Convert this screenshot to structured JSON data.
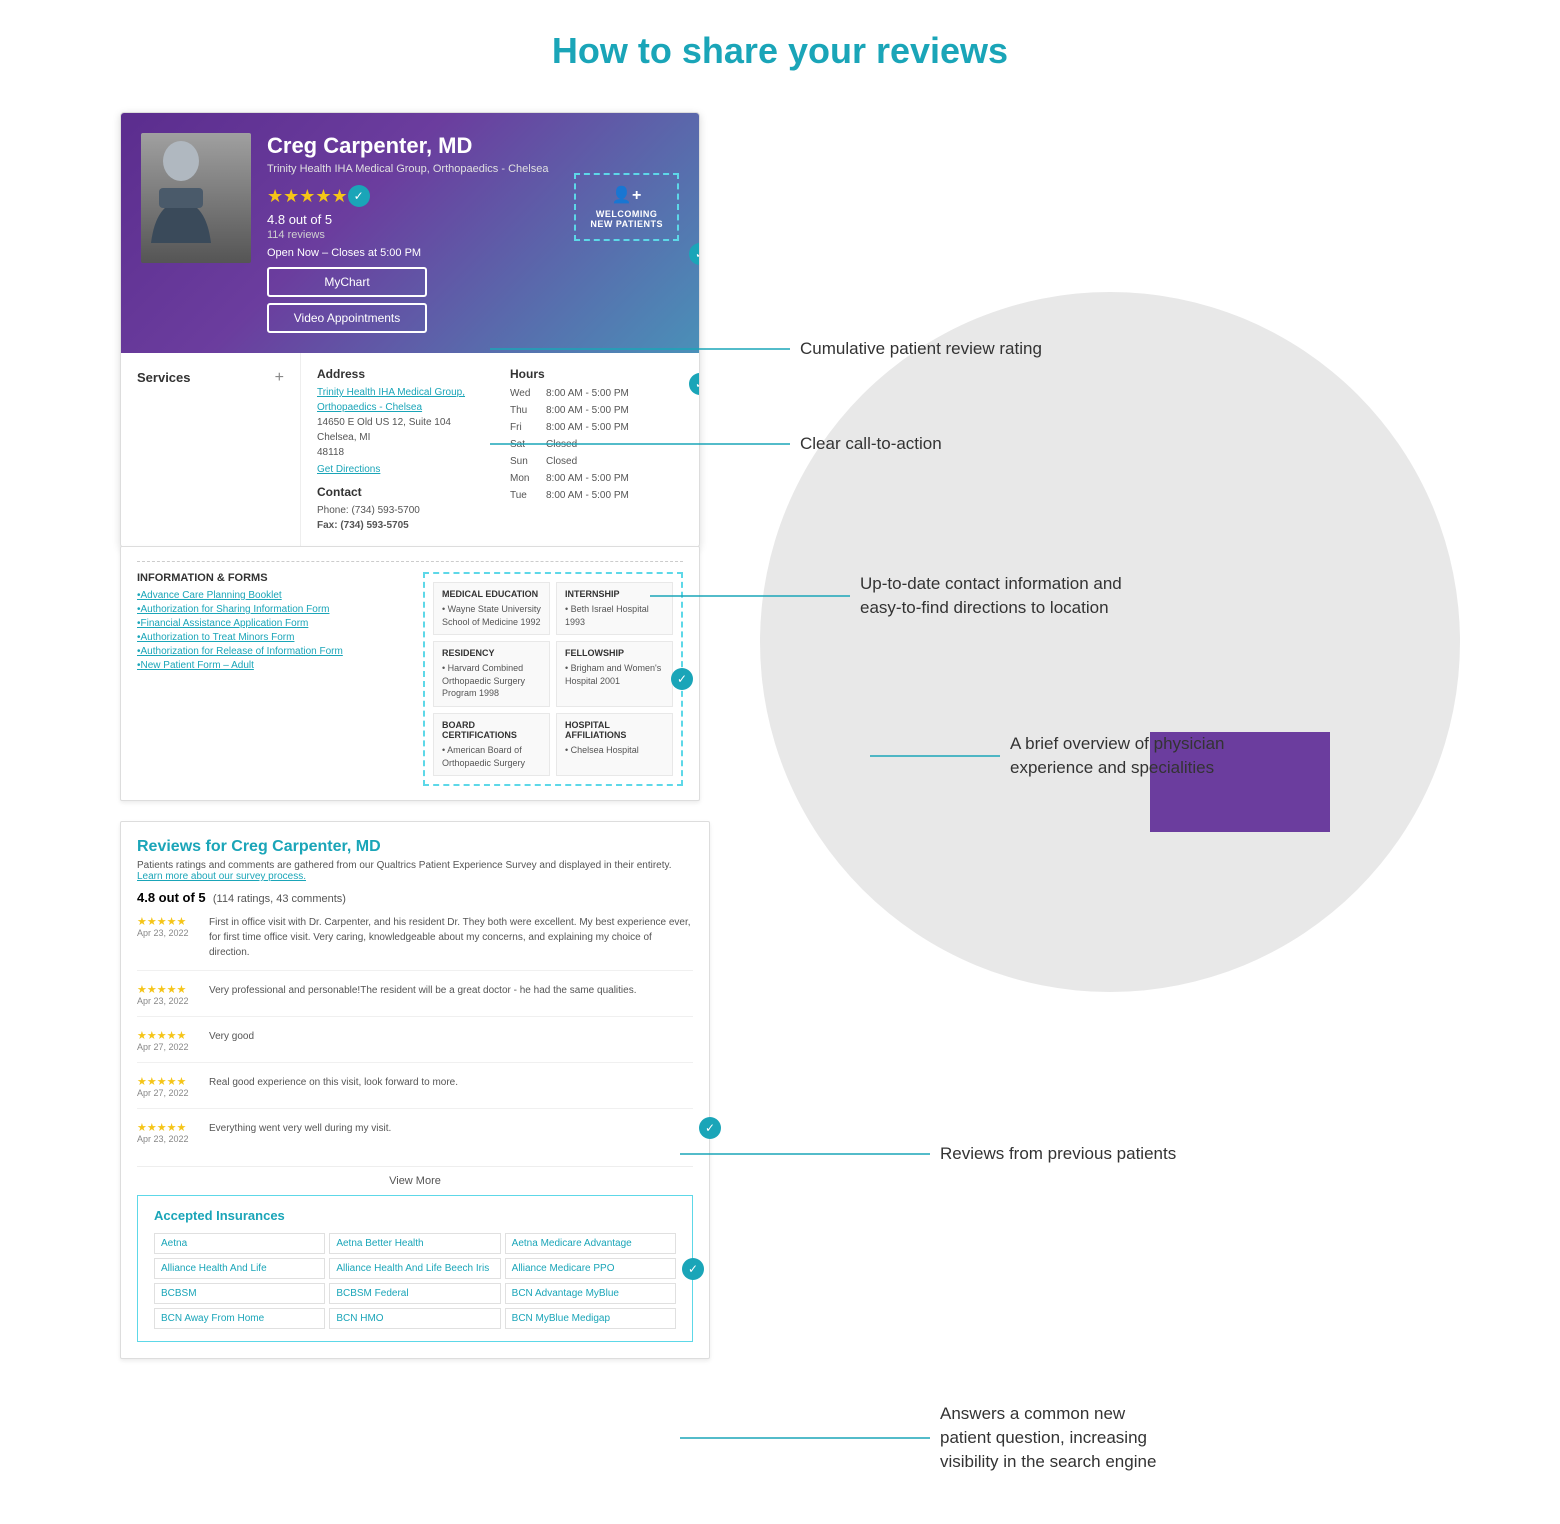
{
  "page": {
    "title": "How to share your reviews"
  },
  "doctor": {
    "name": "Creg Carpenter, MD",
    "organization": "Trinity Health IHA Medical Group, Orthopaedics - Chelsea",
    "rating": "4.8",
    "rating_suffix": "out of 5",
    "review_count": "114 reviews",
    "stars": "★★★★★",
    "open_status": "Open Now",
    "close_time": "– Closes at 5:00 PM",
    "btn_mychart": "MyChart",
    "btn_video": "Video Appointments",
    "welcoming_label": "WELCOMING\nNEW PATIENTS"
  },
  "address": {
    "label": "Address",
    "line1": "Trinity Health IHA Medical Group,",
    "line2": "Orthopaedics - Chelsea",
    "line3": "14650 E Old US 12, Suite 104",
    "line4": "Chelsea, MI",
    "line5": "48118",
    "directions": "Get Directions",
    "contact_label": "Contact",
    "phone": "Phone: (734) 593-5700",
    "fax": "Fax: (734) 593-5705"
  },
  "hours": {
    "label": "Hours",
    "days": [
      {
        "day": "Wed",
        "time": "8:00 AM - 5:00 PM"
      },
      {
        "day": "Thu",
        "time": "8:00 AM - 5:00 PM"
      },
      {
        "day": "Fri",
        "time": "8:00 AM - 5:00 PM"
      },
      {
        "day": "Sat",
        "time": "Closed"
      },
      {
        "day": "Sun",
        "time": "Closed"
      },
      {
        "day": "Mon",
        "time": "8:00 AM - 5:00 PM"
      },
      {
        "day": "Tue",
        "time": "8:00 AM - 5:00 PM"
      }
    ]
  },
  "sidebar": {
    "services_label": "Services"
  },
  "forms": {
    "title": "INFORMATION & FORMS",
    "links": [
      "Advance Care Planning Booklet",
      "Authorization for Sharing Information Form",
      "Financial Assistance Application Form",
      "Authorization to Treat Minors Form",
      "Authorization for Release of Information Form",
      "New Patient Form – Adult"
    ]
  },
  "credentials": {
    "medical_education": {
      "title": "MEDICAL EDUCATION",
      "items": [
        "Wayne State University School of Medicine 1992"
      ]
    },
    "internship": {
      "title": "INTERNSHIP",
      "items": [
        "Beth Israel Hospital 1993"
      ]
    },
    "residency": {
      "title": "RESIDENCY",
      "items": [
        "Harvard Combined Orthopaedic Surgery Program 1998"
      ]
    },
    "fellowship": {
      "title": "FELLOWSHIP",
      "items": [
        "Brigham and Women's Hospital 2001"
      ]
    },
    "board": {
      "title": "BOARD CERTIFICATIONS",
      "items": [
        "American Board of Orthopaedic Surgery"
      ]
    },
    "hospital": {
      "title": "HOSPITAL AFFILIATIONS",
      "items": [
        "Chelsea Hospital"
      ]
    }
  },
  "reviews": {
    "title": "Reviews for Creg Carpenter, MD",
    "subtitle": "Patients ratings and comments are gathered from our Qualtrics Patient Experience Survey and displayed in their entirety.",
    "survey_link": "Learn more about our survey process.",
    "overall": "4.8 out of 5",
    "count": "(114 ratings, 43 comments)",
    "items": [
      {
        "stars": "★★★★★",
        "date": "Apr 23, 2022",
        "text": "First in office visit with Dr. Carpenter, and his resident Dr. They both were excellent. My best experience ever, for first time office visit. Very caring, knowledgeable about my concerns, and explaining my choice of direction."
      },
      {
        "stars": "★★★★★",
        "date": "Apr 23, 2022",
        "text": "Very professional and personable!The resident will be a great doctor - he had the same qualities."
      },
      {
        "stars": "★★★★★",
        "date": "Apr 27, 2022",
        "text": "Very good"
      },
      {
        "stars": "★★★★★",
        "date": "Apr 27, 2022",
        "text": "Real good experience on this visit, look forward to more."
      },
      {
        "stars": "★★★★★",
        "date": "Apr 23, 2022",
        "text": "Everything went very well during my visit."
      }
    ],
    "view_more": "View More"
  },
  "insurance": {
    "title": "Accepted Insurances",
    "items": [
      "Aetna",
      "Aetna Better Health",
      "Aetna Medicare Advantage",
      "Alliance Health And Life",
      "Alliance Health And Life Beech Iris",
      "Alliance Medicare PPO",
      "BCBSM",
      "BCBSM Federal",
      "BCN Advantage MyBlue",
      "BCN Away From Home",
      "BCN HMO",
      "BCN MyBlue Medigap"
    ]
  },
  "annotations": {
    "rating": "Cumulative patient review rating",
    "cta": "Clear call-to-action",
    "contact": "Up-to-date contact information and\neasy-to-find directions to location",
    "physician": "A brief overview of physician\nexperience and specialities",
    "reviews": "Reviews from previous patients",
    "insurance": "Answers a common new\npatient question, increasing\nvisibility in the search engine"
  }
}
